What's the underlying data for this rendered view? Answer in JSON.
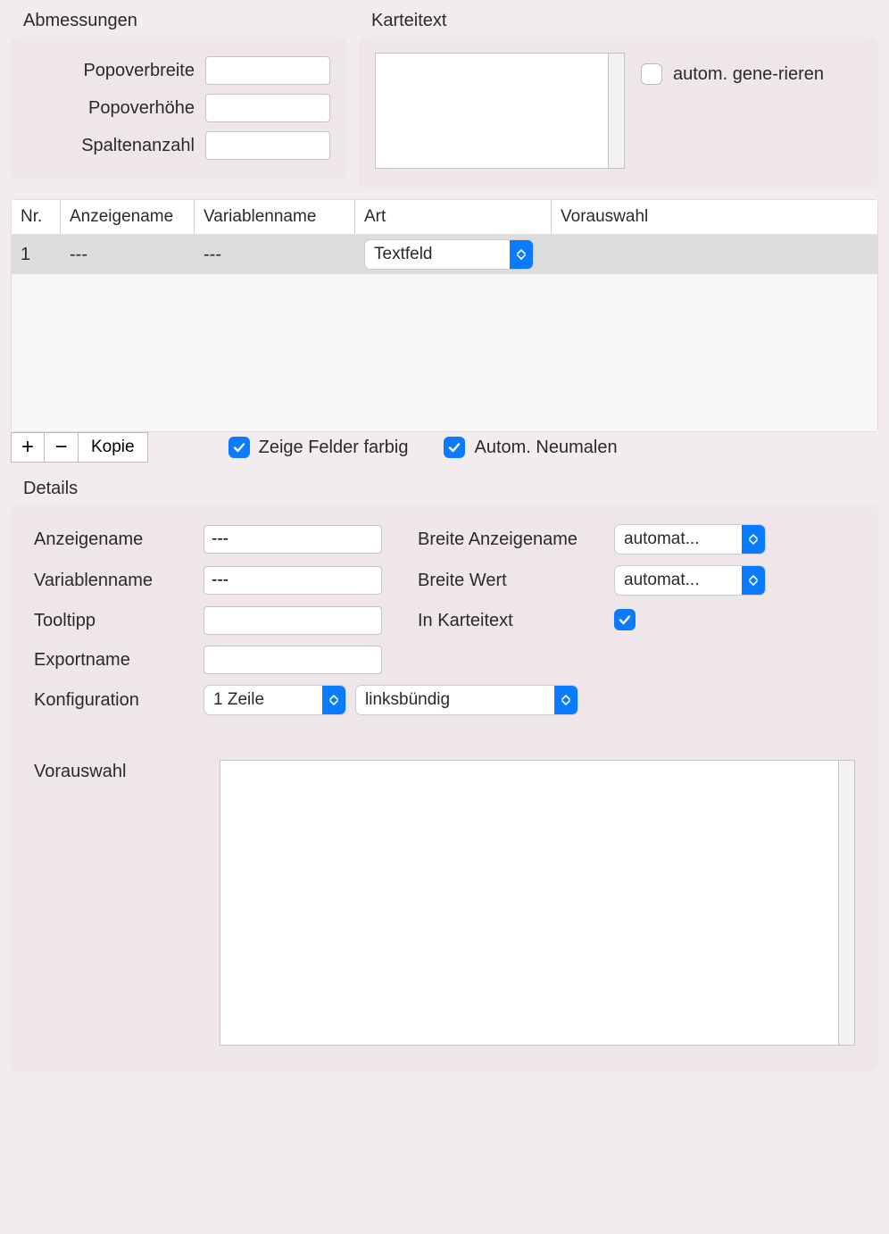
{
  "abmessungen": {
    "title": "Abmessungen",
    "popoverbreite_label": "Popoverbreite",
    "popoverbreite_value": "",
    "popoverhoehe_label": "Popoverhöhe",
    "popoverhoehe_value": "",
    "spaltenanzahl_label": "Spaltenanzahl",
    "spaltenanzahl_value": ""
  },
  "karteitext": {
    "title": "Karteitext",
    "value": "",
    "autogen_label": "autom. gene-rieren",
    "autogen_checked": false
  },
  "table": {
    "headers": {
      "nr": "Nr.",
      "anzeigename": "Anzeigename",
      "variablenname": "Variablenname",
      "art": "Art",
      "vorauswahl": "Vorauswahl"
    },
    "rows": [
      {
        "nr": "1",
        "anzeigename": "---",
        "variablenname": "---",
        "art": "Textfeld",
        "vorauswahl": ""
      }
    ]
  },
  "toolbar": {
    "add": "+",
    "remove": "−",
    "kopie": "Kopie",
    "zeige_felder_farbig": "Zeige Felder farbig",
    "zeige_felder_farbig_checked": true,
    "autom_neumalen": "Autom. Neumalen",
    "autom_neumalen_checked": true
  },
  "details": {
    "title": "Details",
    "anzeigename_label": "Anzeigename",
    "anzeigename_value": "---",
    "variablenname_label": "Variablenname",
    "variablenname_value": "---",
    "tooltipp_label": "Tooltipp",
    "tooltipp_value": "",
    "exportname_label": "Exportname",
    "exportname_value": "",
    "breite_anzeigename_label": "Breite Anzeigename",
    "breite_anzeigename_value": "automat...",
    "breite_wert_label": "Breite Wert",
    "breite_wert_value": "automat...",
    "in_karteitext_label": "In Karteitext",
    "in_karteitext_checked": true,
    "konfiguration_label": "Konfiguration",
    "konfig_lines": "1 Zeile",
    "konfig_align": "linksbündig",
    "vorauswahl_label": "Vorauswahl",
    "vorauswahl_value": ""
  }
}
